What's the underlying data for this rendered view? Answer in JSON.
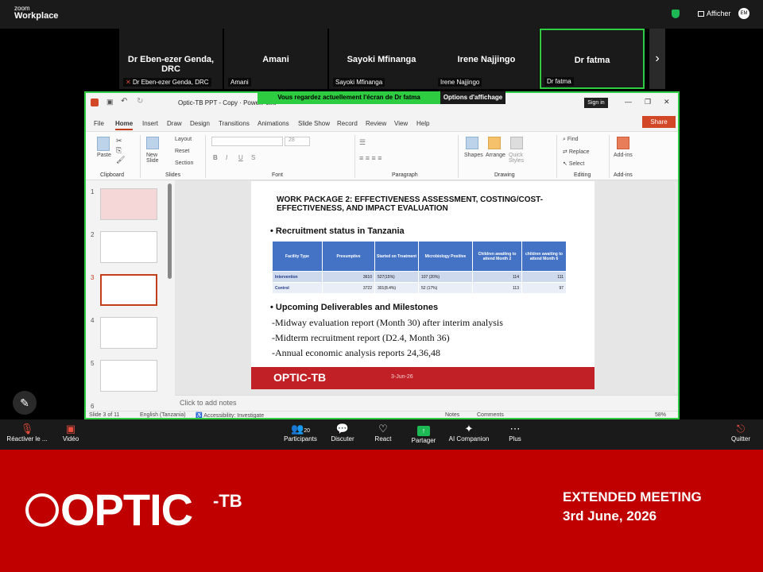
{
  "zoom": {
    "brand_small": "zoom",
    "brand": "Workplace",
    "view_label": "Afficher",
    "avatar": "EM"
  },
  "participants": [
    {
      "name": "Dr Eben-ezer Genda, DRC",
      "tag": "Dr Eben-ezer Genda, DRC"
    },
    {
      "name": "Amani",
      "tag": "Amani"
    },
    {
      "name": "Sayoki Mfinanga",
      "tag": "Sayoki Mfinanga"
    },
    {
      "name": "Irene Najjingo",
      "tag": "Irene Najjingo"
    },
    {
      "name": "Dr fatma",
      "tag": "Dr fatma"
    }
  ],
  "share_banner": {
    "text": "Vous regardez actuellement l'écran de  Dr fatma",
    "options": "Options d'affichage"
  },
  "ppt": {
    "title": "Optic-TB PPT - Copy  ·  PowerPoint",
    "signin": "Sign in",
    "menu": [
      "File",
      "Home",
      "Insert",
      "Draw",
      "Design",
      "Transitions",
      "Animations",
      "Slide Show",
      "Record",
      "Review",
      "View",
      "Help"
    ],
    "share": "Share",
    "ribbon": {
      "paste": "Paste",
      "new_slide": "New Slide",
      "layout": "Layout",
      "reset": "Reset",
      "section": "Section",
      "font_size": "28",
      "find": "Find",
      "replace": "Replace",
      "select": "Select",
      "shapes": "Shapes",
      "arrange": "Arrange",
      "quick_styles": "Quick Styles",
      "addins": "Add-ins",
      "groups": [
        "Clipboard",
        "Slides",
        "Font",
        "Paragraph",
        "Drawing",
        "Editing",
        "Add-ins"
      ]
    },
    "thumb_numbers": [
      "1",
      "2",
      "3",
      "4",
      "5",
      "6"
    ],
    "notes_placeholder": "Click to add notes",
    "status": {
      "slide": "Slide 3 of 11",
      "lang": "English (Tanzania)",
      "access": "Accessibility: Investigate",
      "notes": "Notes",
      "comments": "Comments",
      "zoom": "58%"
    }
  },
  "slide": {
    "title": "WORK PACKAGE 2: EFFECTIVENESS ASSESSMENT, COSTING/COST-EFFECTIVENESS, AND IMPACT EVALUATION",
    "recruit_heading": "• Recruitment status in Tanzania",
    "table": {
      "headers": [
        "Facility Type",
        "Presumptive",
        "Started on Treatment",
        "Microbiology Positive",
        "Children awaiting to attend Month 2",
        "children awaiting to attend Month 6"
      ],
      "rows": [
        [
          "Intervention",
          "3610",
          "527(15%)",
          "107 (20%)",
          "114",
          "111"
        ],
        [
          "Control",
          "3722",
          "301(8.4%)",
          "52 (17%)",
          "113",
          "97"
        ]
      ]
    },
    "upcoming_heading": "• Upcoming Deliverables and Milestones",
    "lines": [
      "-Midway evaluation report (Month 30) after interim analysis",
      "-Midterm recruitment report (D2.4, Month 36)",
      "-Annual economic analysis reports 24,36,48"
    ],
    "footer_logo": "OPTIC-TB",
    "footer_date": "3-Jun-26"
  },
  "toolbar": {
    "mic": "Réactiver le ...",
    "video": "Vidéo",
    "participants": "Participants",
    "participants_count": "20",
    "chat": "Discuter",
    "react": "React",
    "share": "Partager",
    "ai": "AI Companion",
    "more": "Plus",
    "quit": "Quitter"
  },
  "banner": {
    "logo": "OPTIC",
    "tb": "-TB",
    "title": "EXTENDED MEETING",
    "date": "3rd June, 2026"
  }
}
